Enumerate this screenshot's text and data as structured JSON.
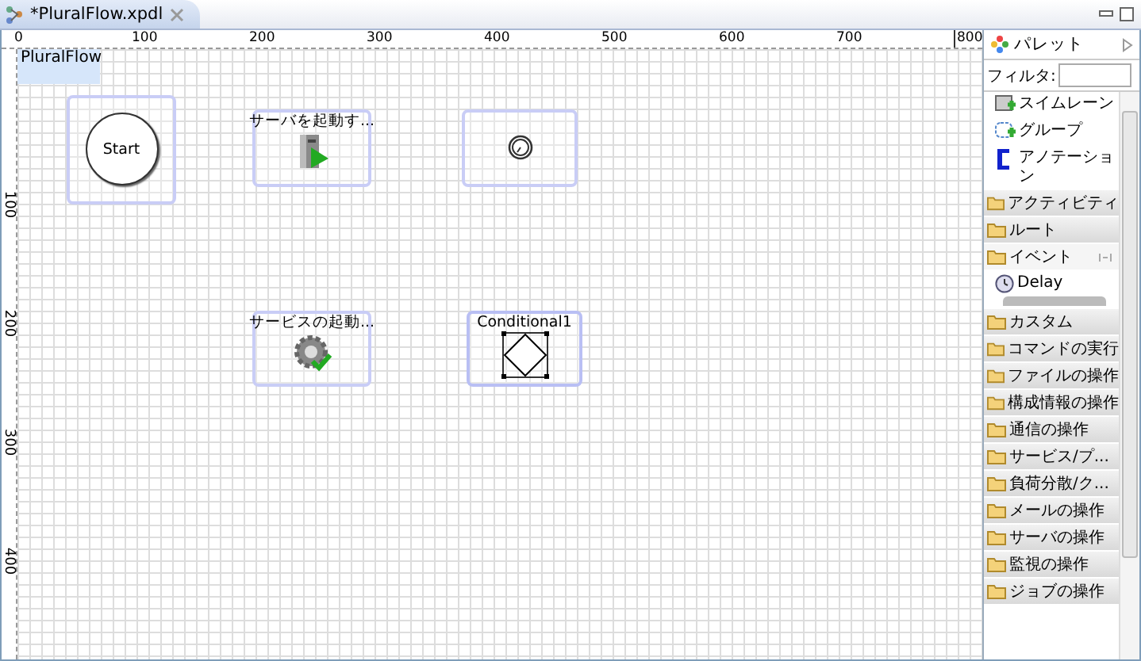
{
  "editor_tab": {
    "title": "*PluralFlow.xpdl",
    "selected": true
  },
  "horizontal_ruler": [
    "0",
    "100",
    "200",
    "300",
    "400",
    "500",
    "600",
    "700",
    "800"
  ],
  "vertical_ruler": [
    "100",
    "200",
    "300",
    "400"
  ],
  "diagram": {
    "pool_label": "PluralFlow",
    "nodes": [
      {
        "kind": "start",
        "label": "Start",
        "selected": false
      },
      {
        "kind": "server-task",
        "label": "サーバを起動す...",
        "selected": false
      },
      {
        "kind": "timer-event",
        "selected": false
      },
      {
        "kind": "service-task",
        "label": "サービスの起動...",
        "selected": false
      },
      {
        "kind": "gateway",
        "label": "Conditional1",
        "selected": true
      }
    ]
  },
  "palette": {
    "title": "パレット",
    "filter_label": "フィルタ:",
    "tools": [
      {
        "kind": "swimlane",
        "label": "スイムレーン"
      },
      {
        "kind": "group",
        "label": "グループ"
      },
      {
        "kind": "annotation",
        "label": "アノテーション"
      }
    ],
    "drawers": [
      {
        "label": "アクティビティ",
        "expanded": false
      },
      {
        "label": "ルート",
        "expanded": false
      },
      {
        "label": "イベント",
        "expanded": true,
        "items": [
          "Delay"
        ]
      },
      {
        "label": "カスタム",
        "expanded": false
      },
      {
        "label": "コマンドの実行",
        "expanded": false
      },
      {
        "label": "ファイルの操作",
        "expanded": false
      },
      {
        "label": "構成情報の操作",
        "expanded": false
      },
      {
        "label": "通信の操作",
        "expanded": false
      },
      {
        "label": "サービス/プ...",
        "expanded": false
      },
      {
        "label": "負荷分散/ク...",
        "expanded": false
      },
      {
        "label": "メールの操作",
        "expanded": false
      },
      {
        "label": "サーバの操作",
        "expanded": false
      },
      {
        "label": "監視の操作",
        "expanded": false
      },
      {
        "label": "ジョブの操作",
        "expanded": false
      }
    ]
  }
}
